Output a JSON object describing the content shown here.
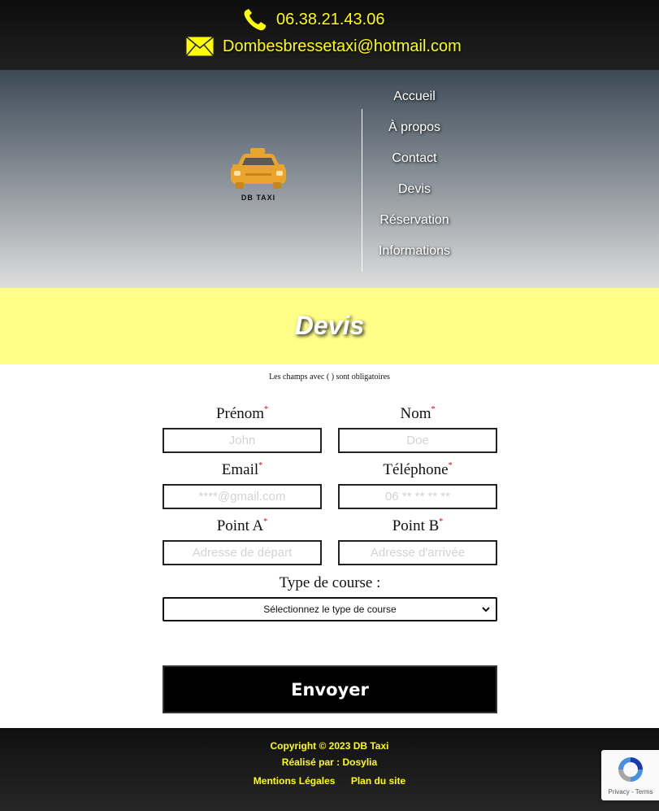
{
  "header": {
    "phone": "06.38.21.43.06",
    "email": "Dombesbressetaxi@hotmail.com",
    "logo_text": "DB TAXI",
    "accent_color": "#ffff00"
  },
  "nav": {
    "items": [
      {
        "label": "Accueil"
      },
      {
        "label": "À propos"
      },
      {
        "label": "Contact"
      },
      {
        "label": "Devis"
      },
      {
        "label": "Réservation"
      },
      {
        "label": "Informations"
      }
    ]
  },
  "page": {
    "title": "Devis",
    "band_color": "#ffff88"
  },
  "form": {
    "required_note": "Les champs avec ( ) sont obligatoires",
    "required_marker": "*",
    "fields": {
      "prenom": {
        "label": "Prénom",
        "placeholder": "John",
        "value": ""
      },
      "nom": {
        "label": "Nom",
        "placeholder": "Doe",
        "value": ""
      },
      "email": {
        "label": "Email",
        "placeholder": "****@gmail.com",
        "value": ""
      },
      "telephone": {
        "label": "Téléphone",
        "placeholder": "06 ** ** ** **",
        "value": ""
      },
      "point_a": {
        "label": "Point A",
        "placeholder": "Adresse de départ",
        "value": ""
      },
      "point_b": {
        "label": "Point B",
        "placeholder": "Adresse d'arrivée",
        "value": ""
      }
    },
    "course_type": {
      "label": "Type de course :",
      "selected": "Sélectionnez le type de course"
    },
    "submit_label": "Envoyer"
  },
  "footer": {
    "copyright": "Copyright © 2023 DB Taxi",
    "credits": "Réalisé par : Dosylia",
    "links": [
      {
        "label": "Mentions Légales"
      },
      {
        "label": "Plan du site"
      }
    ]
  },
  "recaptcha": {
    "links": "Privacy - Terms"
  }
}
